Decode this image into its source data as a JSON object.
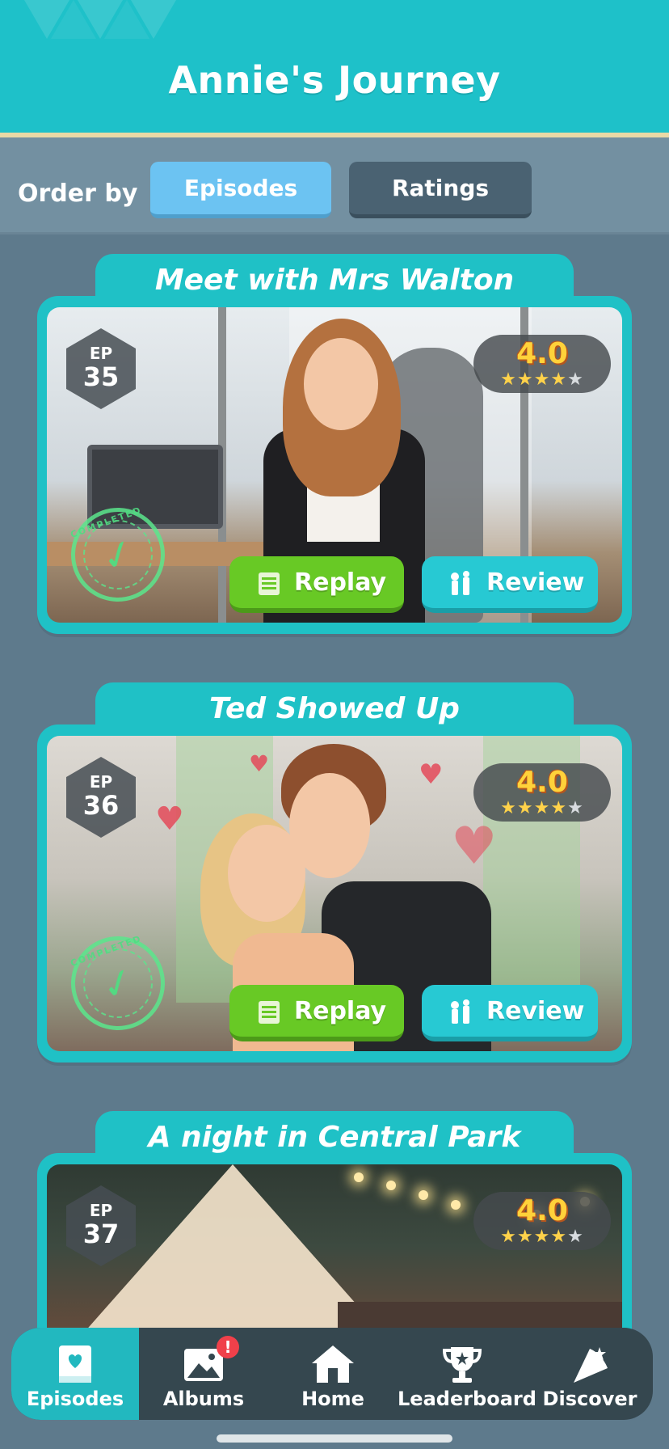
{
  "header": {
    "title": "Annie's Journey"
  },
  "order_bar": {
    "label": "Order by",
    "options": [
      {
        "label": "Episodes",
        "selected": true
      },
      {
        "label": "Ratings",
        "selected": false
      }
    ]
  },
  "episodes": [
    {
      "title": "Meet with Mrs Walton",
      "ep_label": "EP",
      "ep_number": "35",
      "rating": "4.0",
      "stars": 4,
      "max_stars": 5,
      "completed": true,
      "replay_label": "Replay",
      "review_label": "Review",
      "stamp_text": "COMPLETED"
    },
    {
      "title": "Ted Showed Up",
      "ep_label": "EP",
      "ep_number": "36",
      "rating": "4.0",
      "stars": 4,
      "max_stars": 5,
      "completed": true,
      "replay_label": "Replay",
      "review_label": "Review",
      "stamp_text": "COMPLETED"
    },
    {
      "title": "A night in Central Park",
      "ep_label": "EP",
      "ep_number": "37",
      "rating": "4.0",
      "stars": 4,
      "max_stars": 5,
      "completed": false
    }
  ],
  "bottom_nav": {
    "items": [
      {
        "label": "Episodes",
        "icon": "book-heart-icon",
        "active": true
      },
      {
        "label": "Albums",
        "icon": "image-icon",
        "badge": "!"
      },
      {
        "label": "Home",
        "icon": "home-icon"
      },
      {
        "label": "Leaderboard",
        "icon": "trophy-icon"
      },
      {
        "label": "Discover",
        "icon": "discover-icon"
      }
    ]
  },
  "colors": {
    "header": "#1ec1c9",
    "background": "#5e7a8c",
    "replay_button": "#68c925",
    "review_button": "#27c9d3",
    "rating_text": "#ffd23a"
  }
}
